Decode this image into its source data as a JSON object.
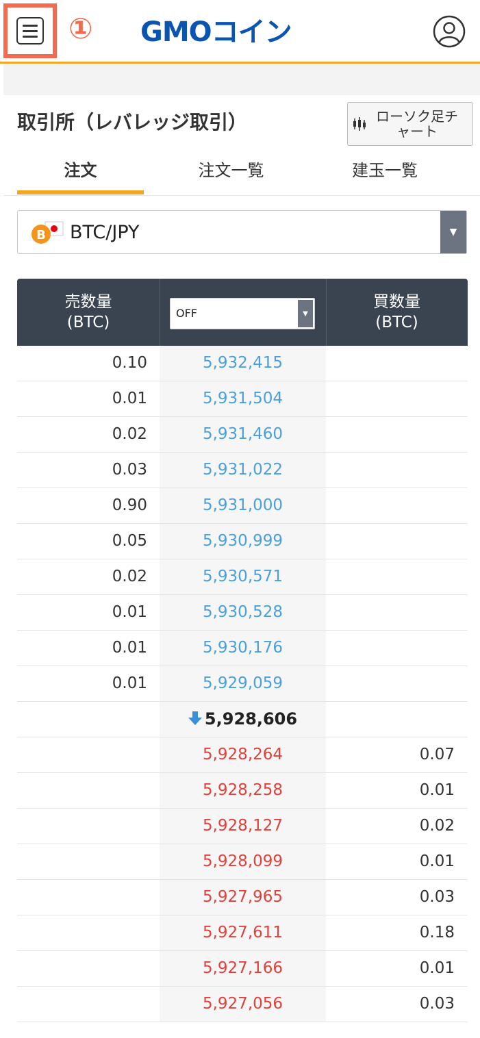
{
  "header": {
    "step_marker": "①",
    "logo_text": "GMOコイン",
    "menu_highlight_color": "#f26b4f",
    "accent_color": "#f5a623"
  },
  "title": {
    "text": "取引所（レバレッジ取引）",
    "chart_button_label": "ローソク足チャート"
  },
  "tabs": [
    {
      "label": "注文",
      "active": true
    },
    {
      "label": "注文一覧",
      "active": false
    },
    {
      "label": "建玉一覧",
      "active": false
    }
  ],
  "pair": {
    "label": "BTC/JPY"
  },
  "book": {
    "sell_header_1": "売数量",
    "sell_header_2": "(BTC)",
    "buy_header_1": "買数量",
    "buy_header_2": "(BTC)",
    "grouping_value": "OFF",
    "last_price": "5,928,606",
    "last_direction": "down",
    "asks": [
      {
        "qty": "0.10",
        "price": "5,932,415"
      },
      {
        "qty": "0.01",
        "price": "5,931,504"
      },
      {
        "qty": "0.02",
        "price": "5,931,460"
      },
      {
        "qty": "0.03",
        "price": "5,931,022"
      },
      {
        "qty": "0.90",
        "price": "5,931,000"
      },
      {
        "qty": "0.05",
        "price": "5,930,999"
      },
      {
        "qty": "0.02",
        "price": "5,930,571"
      },
      {
        "qty": "0.01",
        "price": "5,930,528"
      },
      {
        "qty": "0.01",
        "price": "5,930,176"
      },
      {
        "qty": "0.01",
        "price": "5,929,059"
      }
    ],
    "bids": [
      {
        "price": "5,928,264",
        "qty": "0.07"
      },
      {
        "price": "5,928,258",
        "qty": "0.01"
      },
      {
        "price": "5,928,127",
        "qty": "0.02"
      },
      {
        "price": "5,928,099",
        "qty": "0.01"
      },
      {
        "price": "5,927,965",
        "qty": "0.03"
      },
      {
        "price": "5,927,611",
        "qty": "0.18"
      },
      {
        "price": "5,927,166",
        "qty": "0.01"
      },
      {
        "price": "5,927,056",
        "qty": "0.03"
      }
    ],
    "ask_color": "#4a9fdc",
    "bid_color": "#e0413b"
  }
}
